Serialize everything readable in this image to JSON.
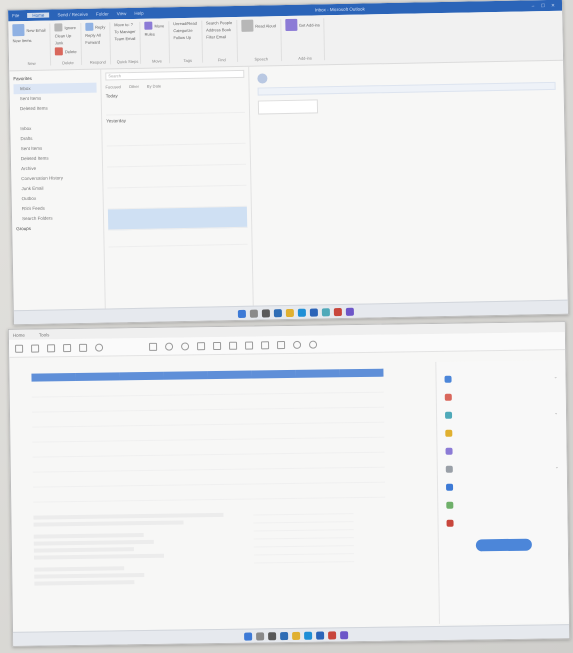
{
  "screen1": {
    "tabs": [
      "File",
      "Home",
      "Send / Receive",
      "Folder",
      "View",
      "Help"
    ],
    "window_title": "Inbox - Microsoft Outlook",
    "ribbon_groups": [
      {
        "label": "New",
        "buttons": [
          "New Email",
          "New Items"
        ]
      },
      {
        "label": "Delete",
        "buttons": [
          "Ignore",
          "Clean Up",
          "Junk",
          "Delete"
        ]
      },
      {
        "label": "Respond",
        "buttons": [
          "Reply",
          "Reply All",
          "Forward"
        ]
      },
      {
        "label": "Quick Steps",
        "buttons": [
          "Move to: ?",
          "To Manager",
          "Team Email"
        ]
      },
      {
        "label": "Move",
        "buttons": [
          "Move",
          "Rules"
        ]
      },
      {
        "label": "Tags",
        "buttons": [
          "Unread/Read",
          "Categorize",
          "Follow Up"
        ]
      },
      {
        "label": "Find",
        "buttons": [
          "Search People",
          "Address Book",
          "Filter Email"
        ]
      },
      {
        "label": "Speech",
        "buttons": [
          "Read Aloud"
        ]
      },
      {
        "label": "Add-ins",
        "buttons": [
          "Get Add-ins"
        ]
      }
    ],
    "folders": [
      {
        "label": "Favorites",
        "header": true
      },
      {
        "label": "Inbox",
        "selected": true
      },
      {
        "label": "Sent Items"
      },
      {
        "label": "Deleted Items"
      },
      {
        "label": "",
        "header": true
      },
      {
        "label": "Inbox"
      },
      {
        "label": "Drafts"
      },
      {
        "label": "Sent Items"
      },
      {
        "label": "Deleted Items"
      },
      {
        "label": "Archive"
      },
      {
        "label": "Conversation History"
      },
      {
        "label": "Junk Email"
      },
      {
        "label": "Outbox"
      },
      {
        "label": "RSS Feeds"
      },
      {
        "label": "Search Folders"
      },
      {
        "label": "Groups",
        "header": true
      }
    ],
    "search_placeholder": "Search",
    "list_tabs": [
      "Focused",
      "Other",
      "By Date"
    ],
    "groups": [
      {
        "label": "Today",
        "messages": [
          {
            "from": "",
            "subject": "",
            "time": ""
          }
        ]
      },
      {
        "label": "Yesterday",
        "messages": [
          {
            "from": "",
            "subject": "",
            "time": ""
          },
          {
            "from": "",
            "subject": "",
            "time": ""
          },
          {
            "from": "",
            "subject": "",
            "time": ""
          },
          {
            "from": "",
            "subject": "",
            "time": ""
          },
          {
            "from": "",
            "subject": "",
            "time": "",
            "selected": true
          },
          {
            "from": "",
            "subject": "",
            "time": ""
          }
        ]
      }
    ],
    "reading": {
      "subject": "",
      "sender": "",
      "body": ""
    },
    "taskbar": {
      "status": "",
      "clock": ""
    }
  },
  "screen2": {
    "window_title": "",
    "tabs": [
      "Home",
      "Tools",
      "",
      ""
    ],
    "sub_toolbar": [
      "",
      ""
    ],
    "table": {
      "headers": [
        "",
        "",
        "",
        "",
        "",
        "",
        "",
        ""
      ],
      "rows": [
        [
          "",
          "",
          "",
          "",
          "",
          "",
          "",
          ""
        ],
        [
          "",
          "",
          "",
          "",
          "",
          "",
          "",
          ""
        ],
        [
          "",
          "",
          "",
          "",
          "",
          "",
          "",
          ""
        ],
        [
          "",
          "",
          "",
          "",
          "",
          "",
          "",
          ""
        ],
        [
          "",
          "",
          "",
          "",
          "",
          "",
          "",
          ""
        ],
        [
          "",
          "",
          "",
          "",
          "",
          "",
          "",
          ""
        ],
        [
          "",
          "",
          "",
          "",
          "",
          "",
          "",
          ""
        ],
        [
          "",
          "",
          "",
          "",
          "",
          "",
          "",
          ""
        ]
      ]
    },
    "notes_label": "",
    "summary_rows": [
      [
        "",
        ""
      ],
      [
        "",
        ""
      ],
      [
        "",
        ""
      ],
      [
        "",
        ""
      ],
      [
        "",
        ""
      ],
      [
        "",
        ""
      ],
      [
        "",
        ""
      ]
    ],
    "side_panel": [
      {
        "label": "",
        "chevron": "⌄"
      },
      {
        "label": "",
        "chevron": ""
      },
      {
        "label": "",
        "chevron": "⌄"
      },
      {
        "label": "",
        "chevron": ""
      },
      {
        "label": "",
        "chevron": ""
      },
      {
        "label": "",
        "chevron": "⌄"
      },
      {
        "label": "",
        "chevron": ""
      },
      {
        "label": "",
        "chevron": ""
      },
      {
        "label": "",
        "chevron": ""
      }
    ],
    "side_note": "",
    "side_button": ""
  },
  "colors": {
    "outlook_blue": "#2b64b8",
    "table_header": "#5f8fd8",
    "side_button": "#4c86d9"
  }
}
